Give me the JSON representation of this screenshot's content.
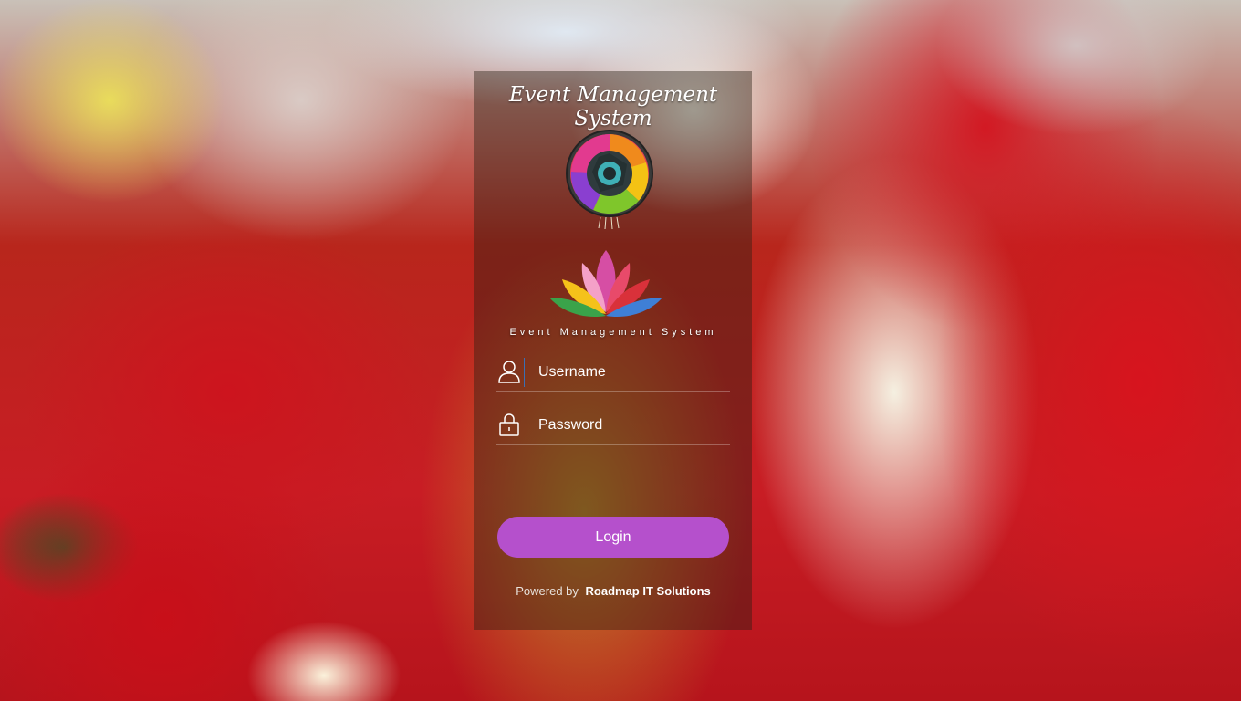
{
  "app": {
    "title": "Event Management System",
    "tagline": "Event Management System"
  },
  "login": {
    "username_placeholder": "Username",
    "password_placeholder": "Password",
    "submit_label": "Login"
  },
  "footer": {
    "powered_by": "Powered by",
    "company": "Roadmap IT Solutions"
  },
  "icons": {
    "username": "user-icon",
    "password": "lock-icon",
    "camera_logo": "camera-shutter-logo",
    "lotus_logo": "lotus-logo"
  },
  "colors": {
    "accent_button": "#b550cc",
    "field_separator": "#3b6fb3"
  }
}
